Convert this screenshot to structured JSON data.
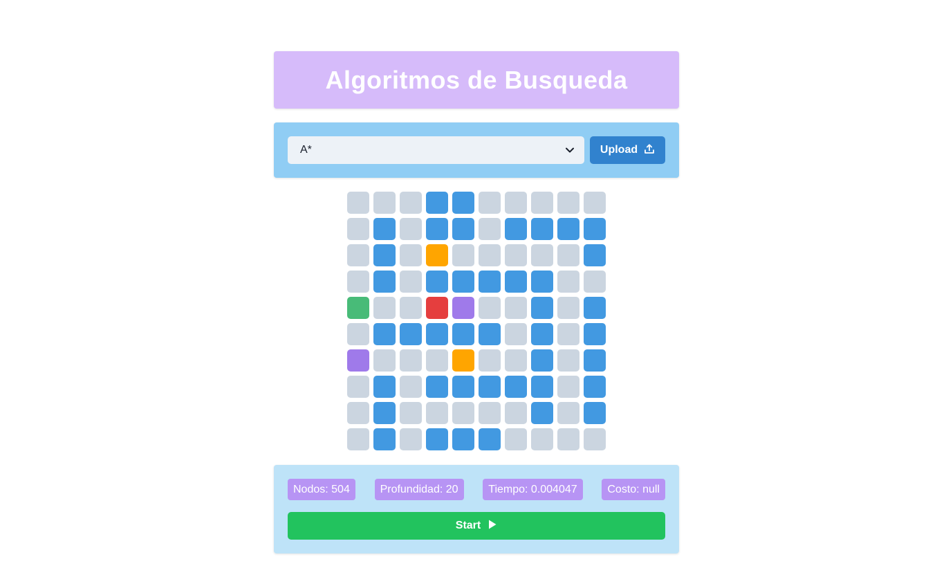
{
  "header": {
    "title": "Algoritmos de Busqueda"
  },
  "controls": {
    "algorithm_selected": "A*",
    "upload_label": "Upload"
  },
  "grid": {
    "legend_colors": {
      "empty": "#cbd5e0",
      "wall": "#4299e1",
      "start": "#48bb78",
      "goal": "#e53e3e",
      "item": "#ffa500",
      "mark": "#9f7aea"
    },
    "cells": [
      [
        0,
        0,
        0,
        1,
        1,
        0,
        0,
        0,
        0,
        0
      ],
      [
        0,
        1,
        0,
        1,
        1,
        0,
        1,
        1,
        1,
        1
      ],
      [
        0,
        1,
        0,
        4,
        0,
        0,
        0,
        0,
        0,
        1
      ],
      [
        0,
        1,
        0,
        1,
        1,
        1,
        1,
        1,
        0,
        0
      ],
      [
        2,
        0,
        0,
        3,
        5,
        0,
        0,
        1,
        0,
        1
      ],
      [
        0,
        1,
        1,
        1,
        1,
        1,
        0,
        1,
        0,
        1
      ],
      [
        5,
        0,
        0,
        0,
        4,
        0,
        0,
        1,
        0,
        1
      ],
      [
        0,
        1,
        0,
        1,
        1,
        1,
        1,
        1,
        0,
        1
      ],
      [
        0,
        1,
        0,
        0,
        0,
        0,
        0,
        1,
        0,
        1
      ],
      [
        0,
        1,
        0,
        1,
        1,
        1,
        0,
        0,
        0,
        0
      ]
    ]
  },
  "stats": {
    "nodes": "Nodos: 504",
    "depth": "Profundidad: 20",
    "time": "Tiempo: 0.004047",
    "cost": "Costo: null"
  },
  "actions": {
    "start_label": "Start"
  }
}
